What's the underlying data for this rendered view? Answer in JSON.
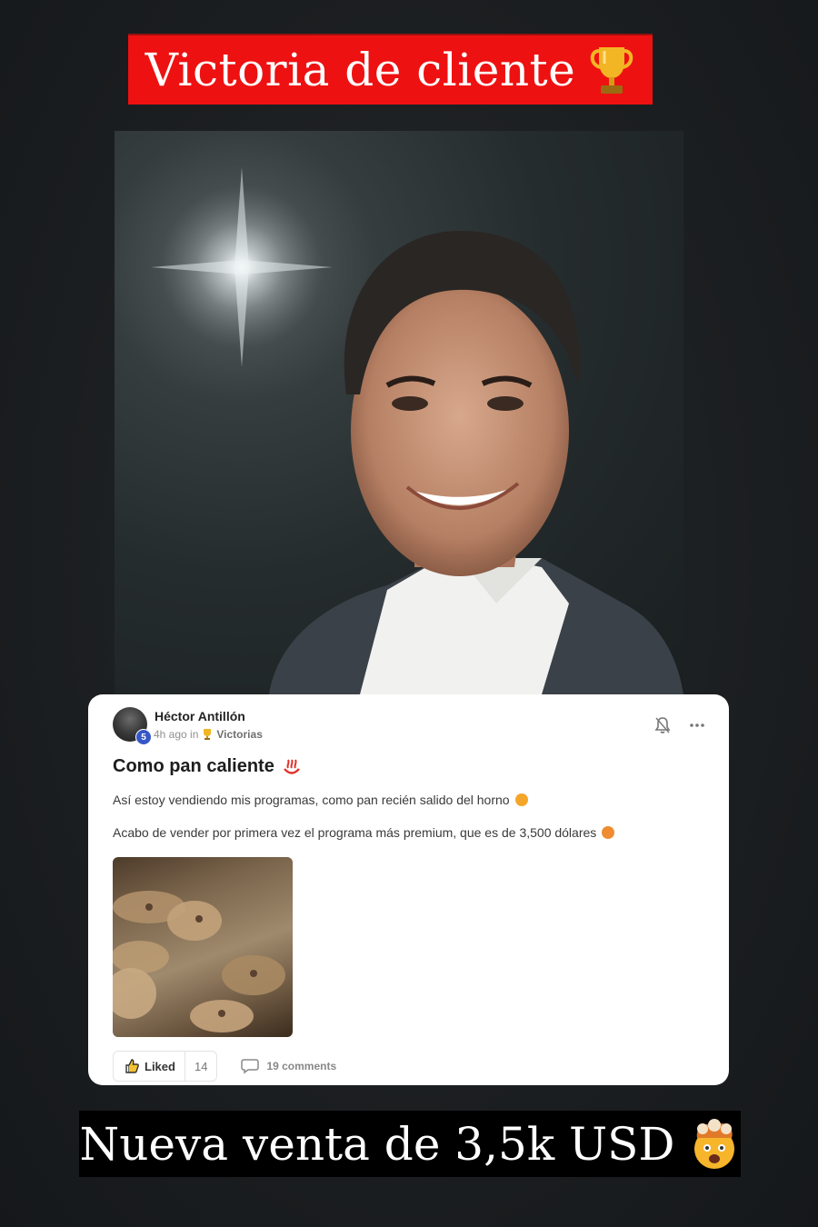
{
  "top_banner": {
    "text": "Victoria de cliente",
    "icon": "trophy-icon",
    "bg_color": "#ee1111"
  },
  "portrait": {
    "icon": "person-photo"
  },
  "post": {
    "author": "Héctor Antillón",
    "level": "5",
    "time": "4h ago in",
    "category": "Victorias",
    "title": "Como pan caliente",
    "paragraph1": "Así estoy vendiendo mis programas, como pan recién salido del horno",
    "paragraph2": "Acabo de vender por primera vez el programa más premium, que es de 3,500 dólares",
    "like_label": "Liked",
    "like_count": "14",
    "comments_label": "19 comments"
  },
  "bottom_banner": {
    "text": "Nueva venta de 3,5k USD",
    "icon": "exploding-head-icon",
    "bg_color": "#000000"
  }
}
